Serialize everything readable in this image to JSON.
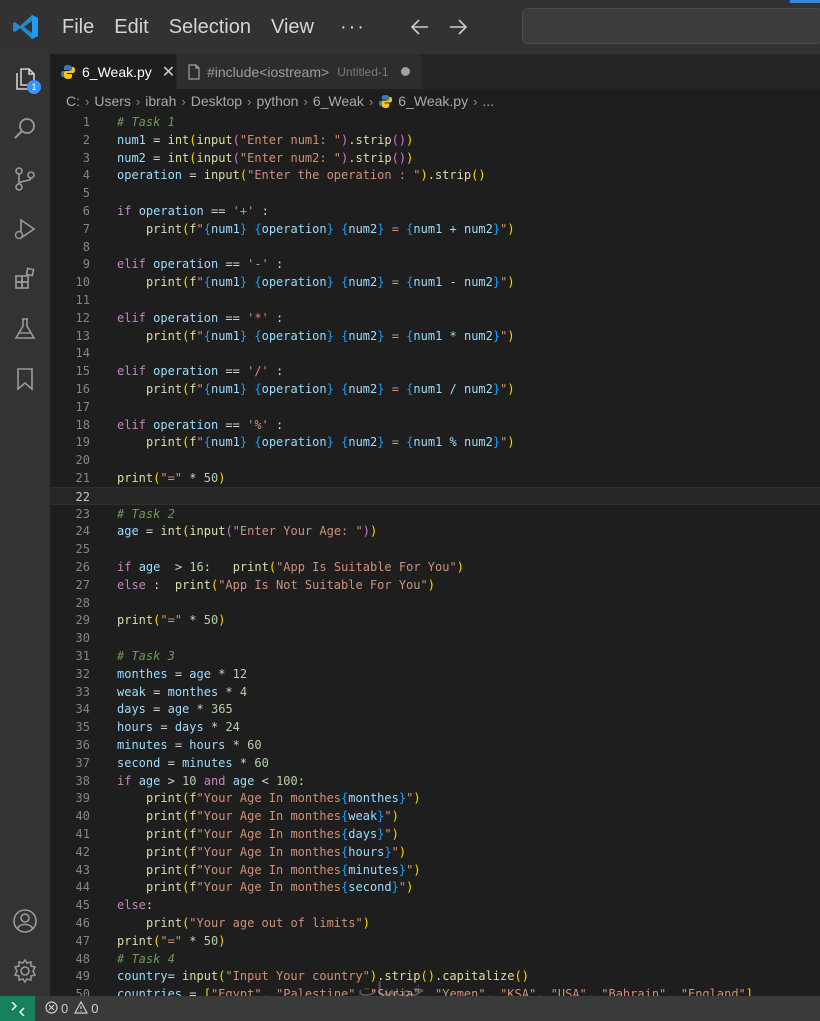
{
  "titlebar": {
    "menu": [
      "File",
      "Edit",
      "Selection",
      "View"
    ],
    "more": "···"
  },
  "activitybar": {
    "explorer_badge": "1",
    "icons": [
      "files-icon",
      "search-icon",
      "source-control-icon",
      "run-debug-icon",
      "extensions-icon",
      "testing-icon",
      "bookmark-icon",
      "account-icon",
      "gear-icon"
    ]
  },
  "tabs": [
    {
      "label": "6_Weak.py",
      "close": "✕"
    },
    {
      "label": "#include<iostream>",
      "desc": "Untitled-1"
    }
  ],
  "breadcrumb": [
    "C:",
    "Users",
    "ibrah",
    "Desktop",
    "python",
    "6_Weak",
    "6_Weak.py",
    "..."
  ],
  "editor": {
    "current_line": 22,
    "lines": [
      "# Task 1",
      "num1 = int(input(\"Enter num1: \").strip())",
      "num2 = int(input(\"Enter num2: \").strip())",
      "operation = input(\"Enter the operation : \").strip()",
      "",
      "if operation == '+' :",
      "    print(f\"{num1} {operation} {num2} = {num1 + num2}\")",
      "",
      "elif operation == '-' :",
      "    print(f\"{num1} {operation} {num2} = {num1 - num2}\")",
      "",
      "elif operation == '*' :",
      "    print(f\"{num1} {operation} {num2} = {num1 * num2}\")",
      "",
      "elif operation == '/' :",
      "    print(f\"{num1} {operation} {num2} = {num1 / num2}\")",
      "",
      "elif operation == '%' :",
      "    print(f\"{num1} {operation} {num2} = {num1 % num2}\")",
      "",
      "print(\"=\" * 50)",
      "",
      "# Task 2",
      "age = int(input(\"Enter Your Age: \"))",
      "",
      "if age  > 16:   print(\"App Is Suitable For You\")",
      "else :  print(\"App Is Not Suitable For You\")",
      "",
      "print(\"=\" * 50)",
      "",
      "# Task 3",
      "monthes = age * 12",
      "weak = monthes * 4",
      "days = age * 365",
      "hours = days * 24",
      "minutes = hours * 60",
      "second = minutes * 60",
      "if age > 10 and age < 100:",
      "    print(f\"Your Age In monthes{monthes}\")",
      "    print(f\"Your Age In monthes{weak}\")",
      "    print(f\"Your Age In monthes{days}\")",
      "    print(f\"Your Age In monthes{hours}\")",
      "    print(f\"Your Age In monthes{minutes}\")",
      "    print(f\"Your Age In monthes{second}\")",
      "else:",
      "    print(\"Your age out of limits\")",
      "print(\"=\" * 50)",
      "# Task 4",
      "country= input(\"Input Your country\").strip().capitalize()",
      "countries = [\"Egypt\", \"Palestine\", \"Syria\", \"Yemen\", \"KSA\", \"USA\", \"Bahrain\", \"England\"]"
    ]
  },
  "statusbar": {
    "errors": "0",
    "warnings": "0"
  },
  "watermark": "خمسات"
}
